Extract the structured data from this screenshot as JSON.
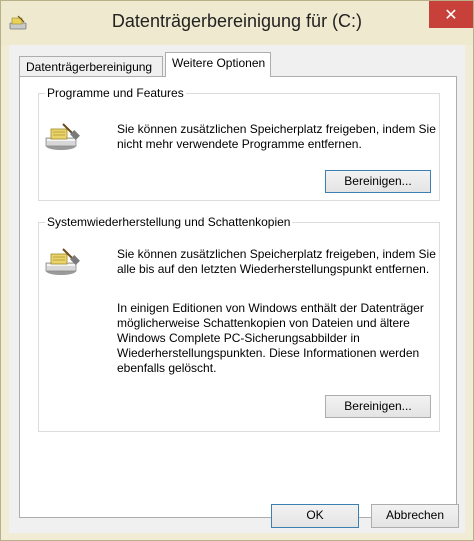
{
  "window": {
    "title": "Datenträgerbereinigung für  (C:)",
    "close_glyph": "✕"
  },
  "tabs": [
    {
      "label": "Datenträgerbereinigung",
      "active": false
    },
    {
      "label": "Weitere Optionen",
      "active": true
    }
  ],
  "groups": {
    "programs": {
      "label": "Programme und Features",
      "text_line1": "Sie können zusätzlichen Speicherplatz freigeben, indem Sie",
      "text_line2": "nicht mehr verwendete Programme entfernen.",
      "button_label": "Bereinigen..."
    },
    "restore": {
      "label": "Systemwiederherstellung und Schattenkopien",
      "text_line1": "Sie können zusätzlichen Speicherplatz freigeben, indem Sie",
      "text_line2": "alle bis auf den letzten Wiederherstellungspunkt entfernen.",
      "info_line1": "In einigen Editionen von Windows enthält der Datenträger",
      "info_line2": "möglicherweise Schattenkopien von Dateien und ältere",
      "info_line3": "Windows Complete PC-Sicherungsabbilder in",
      "info_line4": "Wiederherstellungspunkten. Diese Informationen werden",
      "info_line5": "ebenfalls gelöscht.",
      "button_label": "Bereinigen..."
    }
  },
  "footer": {
    "ok_label": "OK",
    "cancel_label": "Abbrechen"
  },
  "colors": {
    "titlebar": "#efe9cf",
    "close_button": "#c7413a",
    "panel": "#ffffff",
    "button_border_default": "#3c7fb1"
  }
}
